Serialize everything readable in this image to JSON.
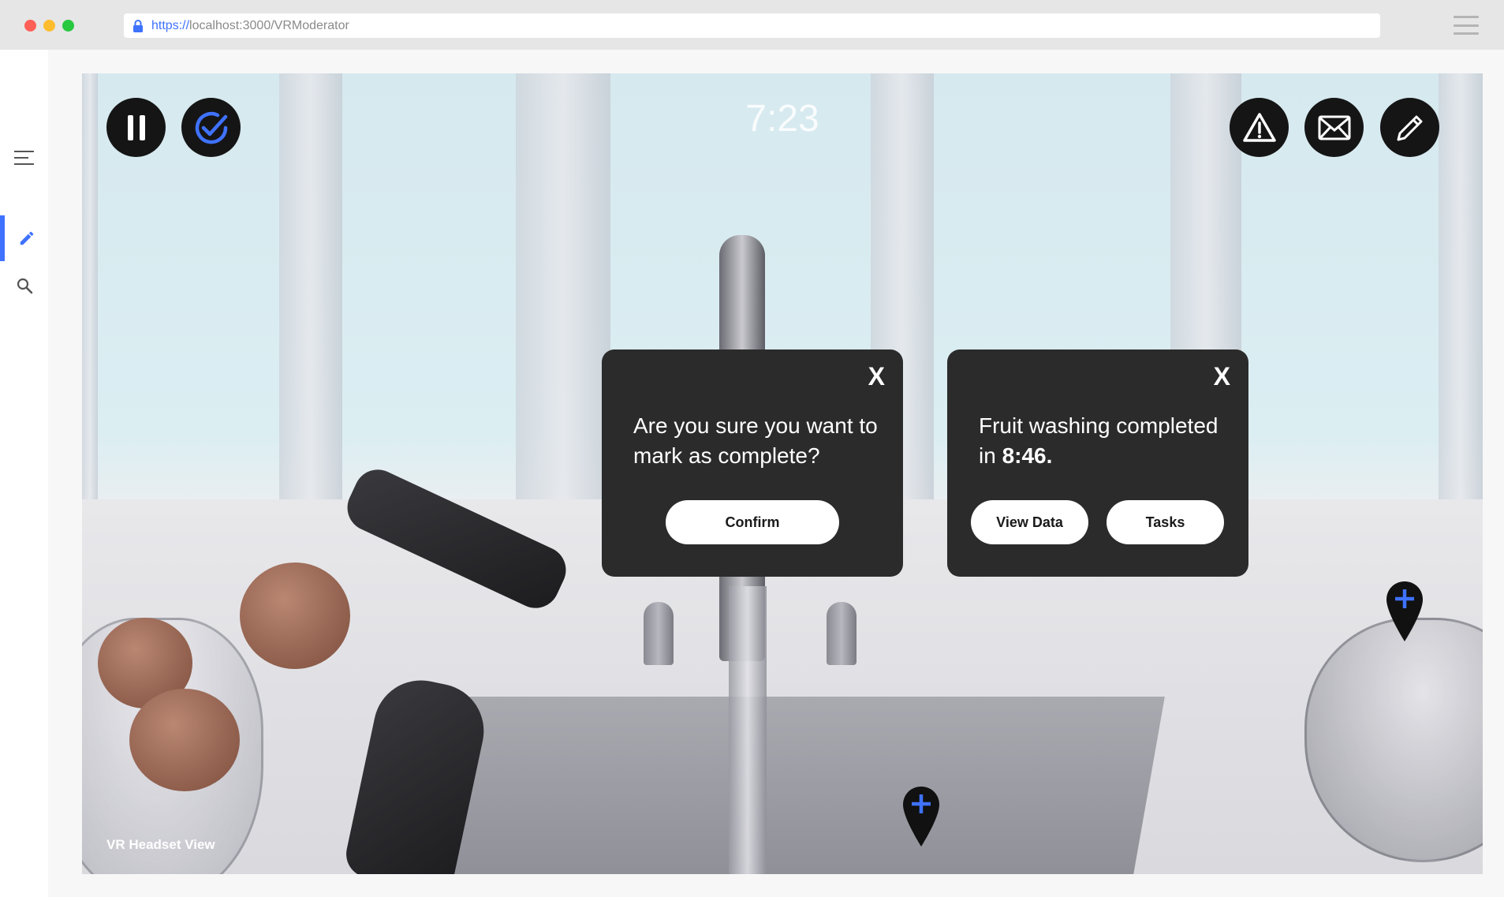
{
  "browser": {
    "url_protocol": "https://",
    "url_path": "localhost:3000/VRModerator"
  },
  "sidebar": {
    "items": [
      {
        "icon": "pencil-icon",
        "active": true
      },
      {
        "icon": "search-icon",
        "active": false
      }
    ]
  },
  "toolbar": {
    "left_buttons": [
      "pause-icon",
      "check-circle-icon"
    ],
    "right_buttons": [
      "warning-icon",
      "mail-icon",
      "pencil-icon"
    ],
    "timer": "7:23"
  },
  "confirm_modal": {
    "close_label": "X",
    "message": "Are you sure you want to mark as complete?",
    "confirm_label": "Confirm"
  },
  "result_modal": {
    "close_label": "X",
    "message_prefix": "Fruit washing completed in ",
    "message_time": "8:46.",
    "view_data_label": "View Data",
    "tasks_label": "Tasks"
  },
  "markers": [
    "add-pin-icon",
    "add-pin-icon"
  ],
  "viewport": {
    "caption": "VR Headset View"
  },
  "colors": {
    "accent": "#3f72ff",
    "modal_bg": "#2b2b2b",
    "button_bg": "#151515"
  }
}
